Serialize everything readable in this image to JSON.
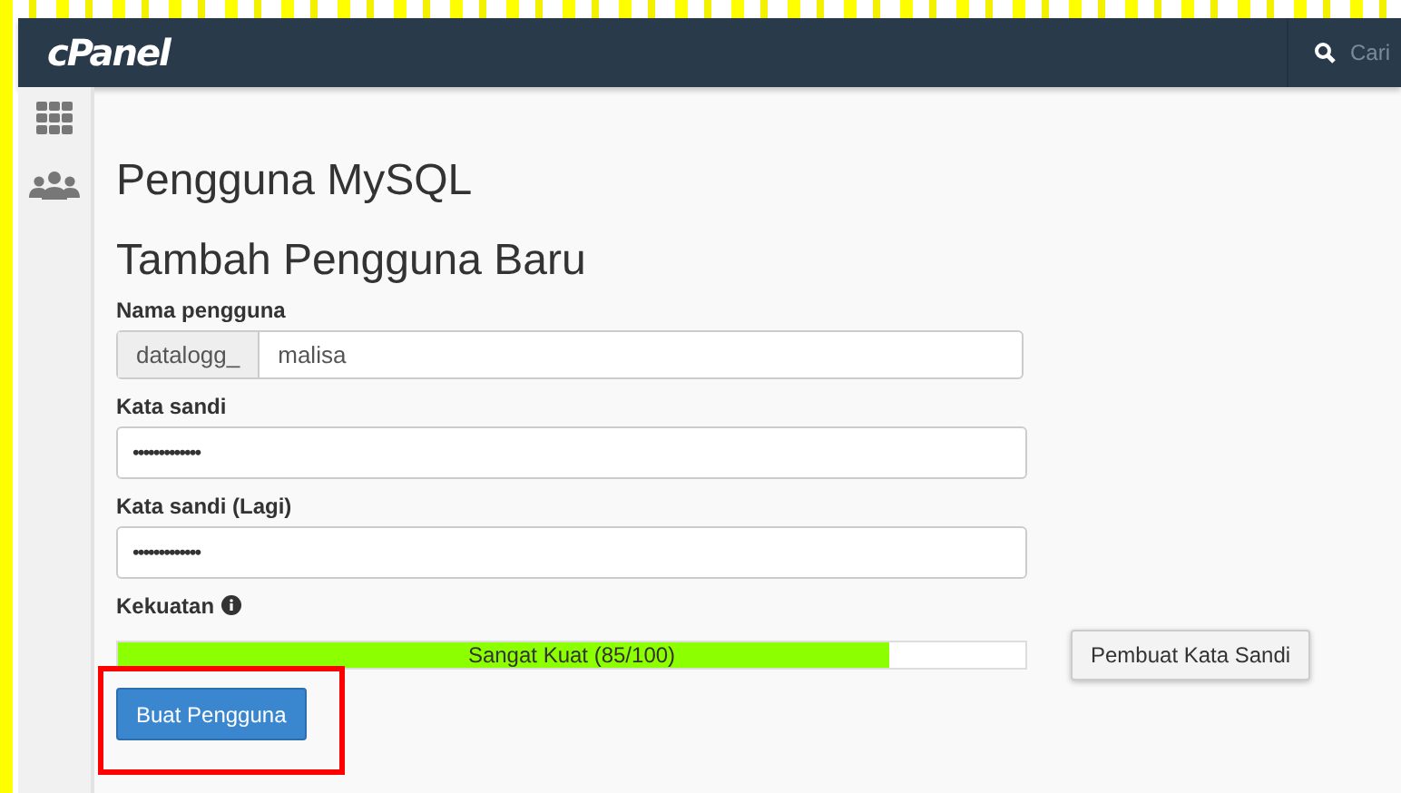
{
  "header": {
    "logo": "cPanel",
    "search_placeholder": "Cari"
  },
  "sidebar": {
    "items": [
      {
        "kind": "grid"
      },
      {
        "kind": "users"
      }
    ]
  },
  "page_title": "Pengguna MySQL",
  "section_title": "Tambah Pengguna Baru",
  "fields": [
    {
      "kind": "prefixed",
      "label": "Nama pengguna",
      "prefix": "datalogg_",
      "value": "malisa"
    },
    {
      "kind": "password",
      "label": "Kata sandi",
      "value": "•••••••••••••"
    },
    {
      "kind": "password",
      "label": "Kata sandi (Lagi)",
      "value": "•••••••••••••"
    }
  ],
  "strength": {
    "label": "Kekuatan",
    "level": 0.85,
    "reading": "Sangat Kuat (85/100)"
  },
  "generator_button": "Pembuat Kata Sandi",
  "submit_button": {
    "label": "Buat Pengguna",
    "highlighted": true
  }
}
